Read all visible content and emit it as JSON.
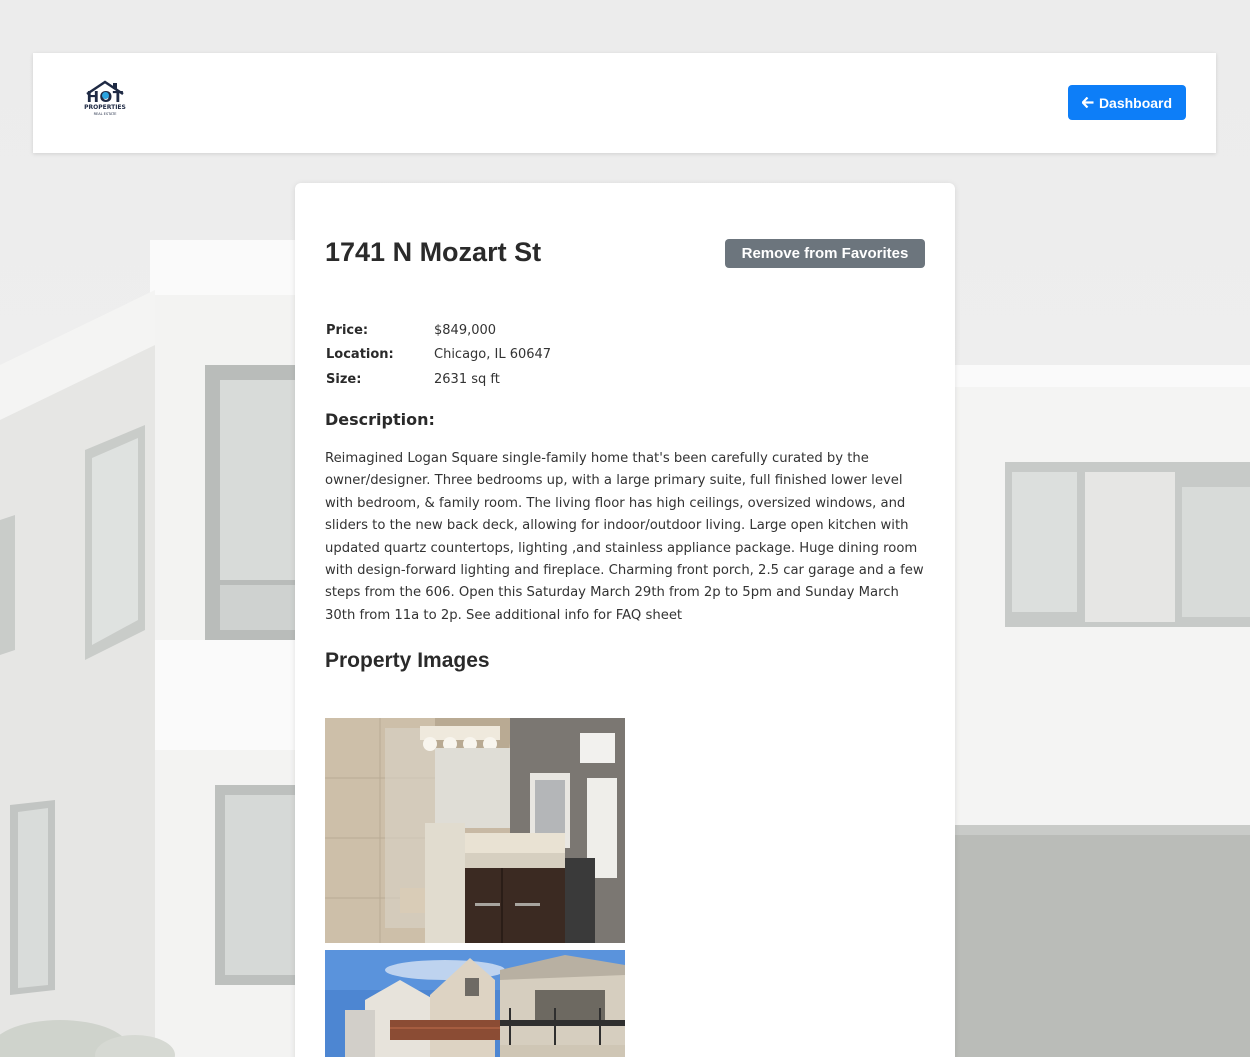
{
  "header": {
    "logo": {
      "line1": "HOT",
      "line2": "PROPERTIES",
      "line3": "REAL ESTATE",
      "icon": "house-logo-icon"
    },
    "dashboard_button": {
      "label": "Dashboard",
      "icon": "arrow-left-icon"
    }
  },
  "property": {
    "title": "1741 N Mozart St",
    "favorite_button_label": "Remove from Favorites",
    "facts": [
      {
        "label": "Price:",
        "value": "$849,000"
      },
      {
        "label": "Location:",
        "value": "Chicago, IL 60647"
      },
      {
        "label": "Size:",
        "value": "2631 sq ft"
      }
    ],
    "description_heading": "Description:",
    "description": "Reimagined Logan Square single-family home that's been carefully curated by the owner/designer. Three bedrooms up, with a large primary suite, full finished lower level with bedroom, & family room. The living floor has high ceilings, oversized windows, and sliders to the new back deck, allowing for indoor/outdoor living. Large open kitchen with updated quartz countertops, lighting ,and stainless appliance package. Huge dining room with design-forward lighting and fireplace. Charming front porch, 2.5 car garage and a few steps from the 606. Open this Saturday March 29th from 2p to 5pm and Sunday March 30th from 11a to 2p. See additional info for FAQ sheet",
    "images_heading": "Property Images"
  },
  "colors": {
    "primary": "#0d7ef8",
    "secondary": "#6c757d",
    "logo_dark": "#1f2a44",
    "logo_accent": "#2aa3e0"
  }
}
